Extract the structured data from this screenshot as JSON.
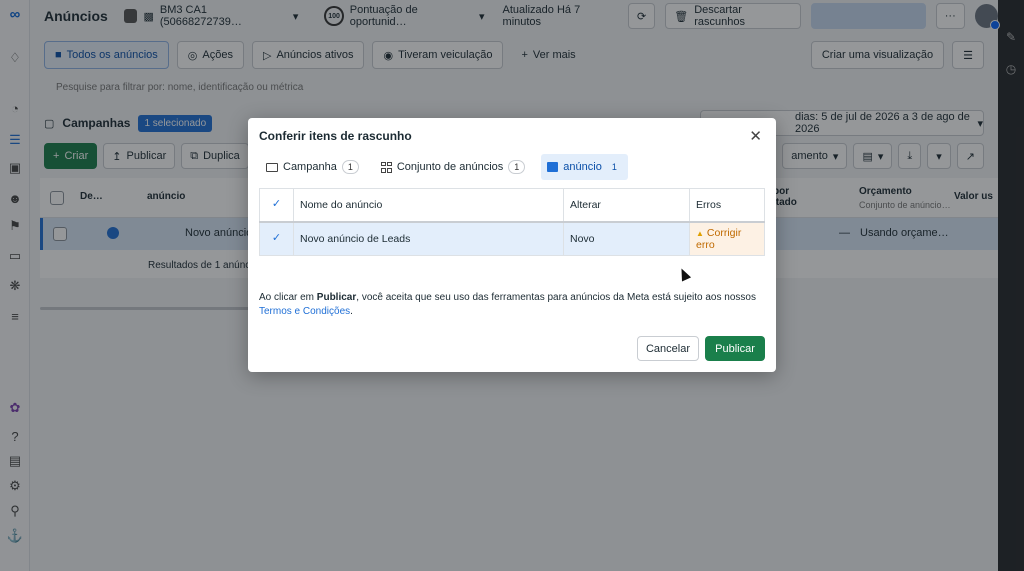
{
  "header": {
    "title": "Anúncios",
    "account": "BM3 CA1 (50668272739…",
    "score_badge": "100",
    "score_label": "Pontuação de oportunid…",
    "updated": "Atualizado Há 7 minutos",
    "discard": "Descartar rascunhos",
    "more": "···"
  },
  "tabs": [
    {
      "label": "Todos os anúncios"
    },
    {
      "label": "Ações"
    },
    {
      "label": "Anúncios ativos"
    },
    {
      "label": "Tiveram veiculação"
    },
    {
      "label": "Ver mais"
    }
  ],
  "create_view": "Criar uma visualização",
  "filter_placeholder": "Pesquise para filtrar por: nome, identificação ou métrica",
  "campaigns": {
    "label": "Campanhas",
    "selected": "1 selecionado",
    "date_range": "dias: 5 de jul de 2026 a 3 de ago de 2026"
  },
  "toolbar": {
    "create": "Criar",
    "publish": "Publicar",
    "duplicate": "Duplica",
    "breakdown": "amento"
  },
  "table": {
    "col_de": "De…",
    "col_ad": "anúncio",
    "col_result": "por\nltado",
    "col_budget": "Orçamento",
    "col_budget_sub": "Conjunto de anúncio…",
    "col_value": "Valor us",
    "row_name": "Novo anúncio",
    "row_dash": "—",
    "row_budget": "Usando orçame…",
    "results": "Resultados de 1 anúnc"
  },
  "modal": {
    "title": "Conferir itens de rascunho",
    "tabs": [
      {
        "label": "Campanha",
        "count": "1"
      },
      {
        "label": "Conjunto de anúncios",
        "count": "1"
      },
      {
        "label": "anúncio",
        "count": "1"
      }
    ],
    "columns": {
      "name": "Nome do anúncio",
      "change": "Alterar",
      "errors": "Erros"
    },
    "rows": [
      {
        "name": "Novo anúncio de Leads",
        "change": "Novo",
        "error": "Corrigir erro"
      }
    ],
    "consent_prefix": "Ao clicar em ",
    "consent_bold": "Publicar",
    "consent_suffix": ", você aceita que seu uso das ferramentas para anúncios da Meta está sujeito aos nossos",
    "consent_link": "Termos e Condições",
    "consent_end": ".",
    "cancel": "Cancelar",
    "publish": "Publicar"
  },
  "colors": {
    "accent": "#1f6fd6",
    "publish": "#1a7f4b",
    "error": "#c06a00"
  }
}
